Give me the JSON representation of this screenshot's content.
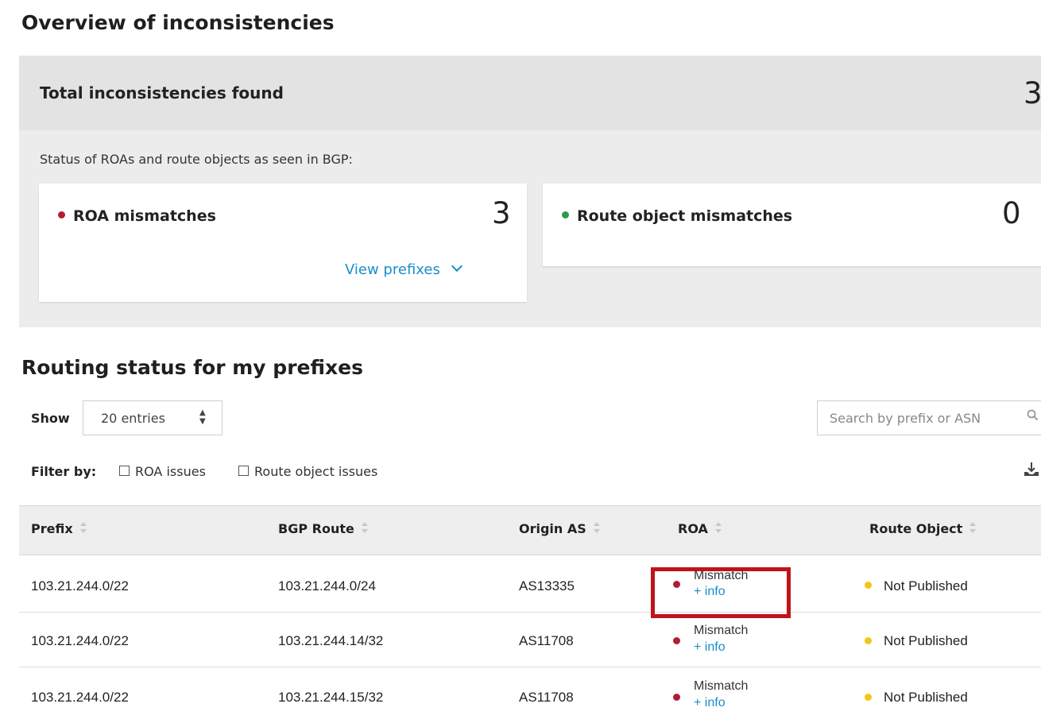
{
  "overview": {
    "title": "Overview of inconsistencies",
    "total_label": "Total inconsistencies found",
    "total_count": "3",
    "status_text": "Status of ROAs and route objects as seen in BGP:",
    "roa_card": {
      "label": "ROA mismatches",
      "count": "3",
      "link": "View prefixes",
      "dot_color": "#b01e33"
    },
    "route_object_card": {
      "label": "Route object mismatches",
      "count": "0",
      "dot_color": "#2e9a4b"
    }
  },
  "routing": {
    "title": "Routing status for my prefixes",
    "show_label": "Show",
    "entries_value": "20 entries",
    "search_placeholder": "Search by prefix or ASN",
    "filter_label": "Filter by:",
    "filters": [
      "ROA issues",
      "Route object issues"
    ],
    "columns": [
      "Prefix",
      "BGP Route",
      "Origin AS",
      "ROA",
      "Route Object"
    ],
    "rows": [
      {
        "prefix": "103.21.244.0/22",
        "bgp_route": "103.21.244.0/24",
        "origin_as": "AS13335",
        "roa": "Mismatch",
        "roa_link": "+ info",
        "route_object": "Not Published"
      },
      {
        "prefix": "103.21.244.0/22",
        "bgp_route": "103.21.244.14/32",
        "origin_as": "AS11708",
        "roa": "Mismatch",
        "roa_link": "+ info",
        "route_object": "Not Published"
      },
      {
        "prefix": "103.21.244.0/22",
        "bgp_route": "103.21.244.15/32",
        "origin_as": "AS11708",
        "roa": "Mismatch",
        "roa_link": "+ info",
        "route_object": "Not Published"
      }
    ]
  },
  "colors": {
    "link": "#1a8fc9",
    "mismatch": "#b01e33",
    "not_published": "#f5c518",
    "highlight": "#c0141a"
  }
}
